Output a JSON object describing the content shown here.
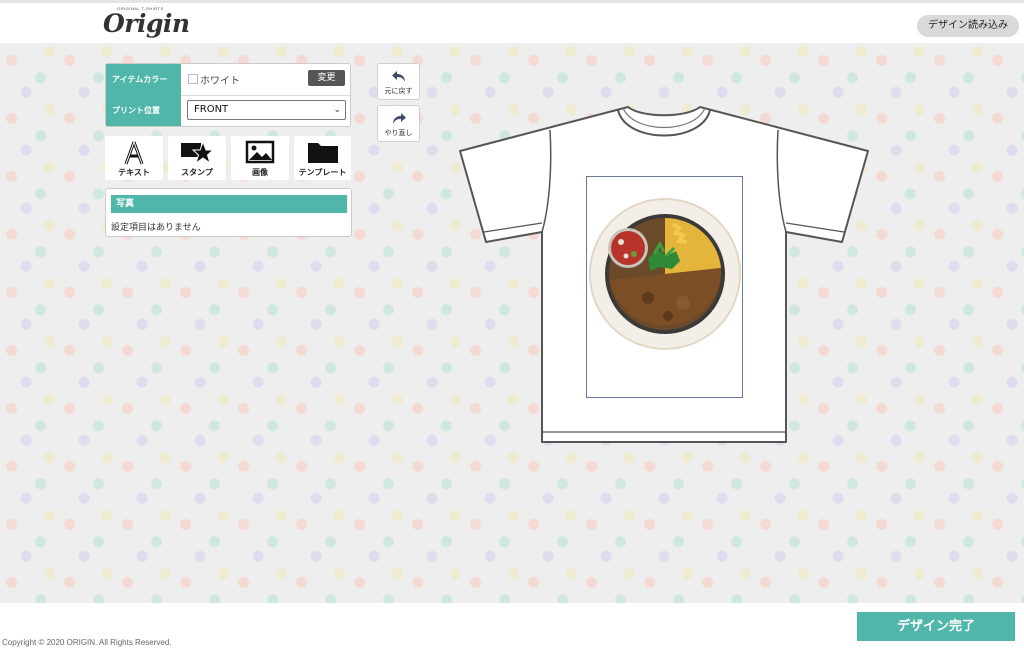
{
  "header": {
    "logo_sub": "ORIGINAL T-SHIRTS",
    "logo": "Origin",
    "load_design_label": "デザイン読み込み"
  },
  "settings": {
    "item_color_label": "アイテムカラー",
    "item_color_value": "ホワイト",
    "change_label": "変更",
    "print_position_label": "プリント位置",
    "print_position_value": "FRONT"
  },
  "tools": [
    {
      "label": "テキスト",
      "icon": "text-icon"
    },
    {
      "label": "スタンプ",
      "icon": "stamp-icon"
    },
    {
      "label": "画像",
      "icon": "image-icon"
    },
    {
      "label": "テンプレート",
      "icon": "folder-icon"
    }
  ],
  "layers": {
    "title": "写真",
    "empty_message": "設定項目はありません"
  },
  "history": {
    "undo_label": "元に戻す",
    "redo_label": "やり直し"
  },
  "canvas": {
    "design": "curry-plate-image",
    "shirt_color": "#ffffff"
  },
  "footer": {
    "copyright": "Copyright © 2020 ORIGIN. All Rights Reserved.",
    "done_label": "デザイン完了"
  },
  "colors": {
    "accent": "#4fb6a9",
    "dark_button": "#555555"
  }
}
